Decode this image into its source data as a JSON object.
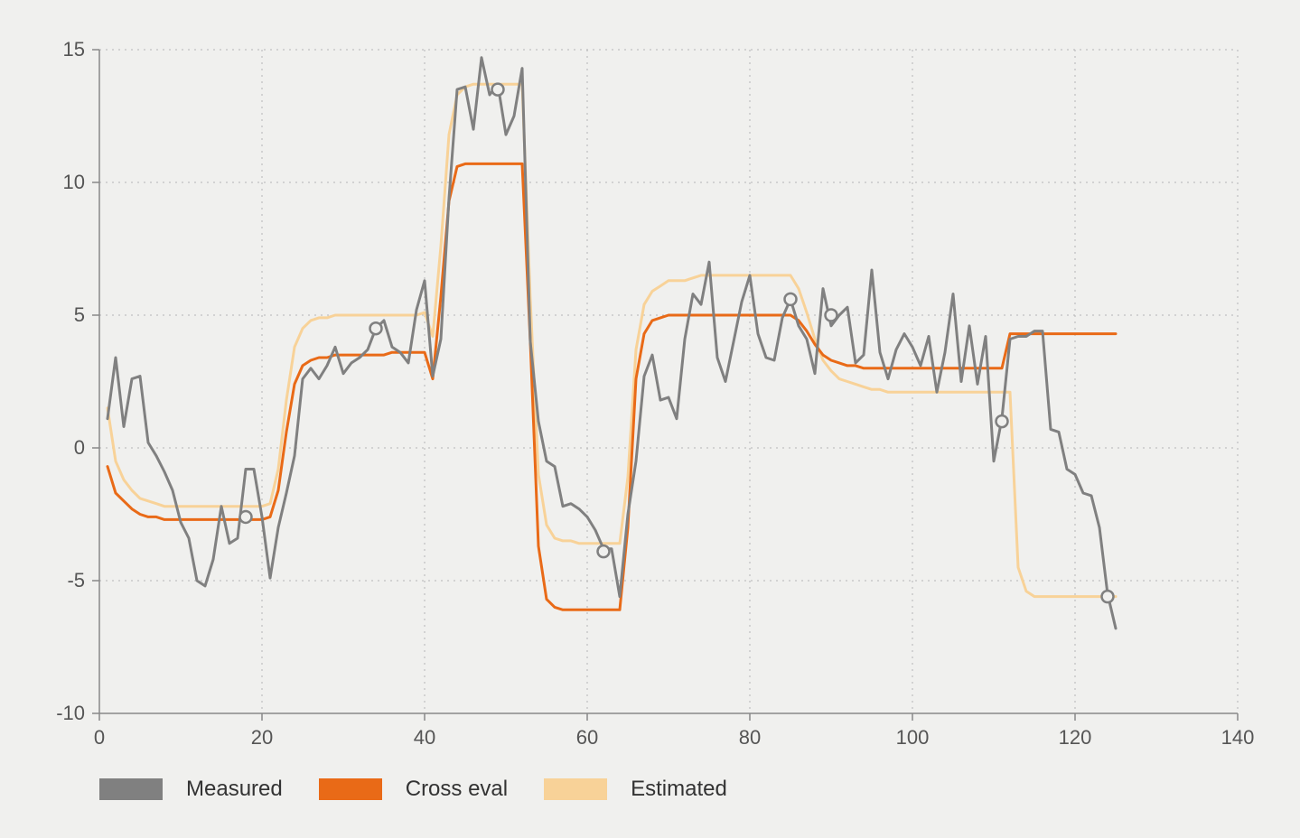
{
  "chart_data": {
    "type": "line",
    "xlabel": "",
    "ylabel": "",
    "xlim": [
      0,
      140
    ],
    "ylim": [
      -10,
      15
    ],
    "xticks": [
      0,
      20,
      40,
      60,
      80,
      100,
      120,
      140
    ],
    "yticks": [
      -10,
      -5,
      0,
      5,
      10,
      15
    ],
    "legend": [
      "Measured",
      "Cross eval",
      "Estimated"
    ],
    "series": [
      {
        "name": "Measured",
        "color": "#808080",
        "x": [
          1,
          2,
          3,
          4,
          5,
          6,
          7,
          8,
          9,
          10,
          11,
          12,
          13,
          14,
          15,
          16,
          17,
          18,
          19,
          20,
          21,
          22,
          23,
          24,
          25,
          26,
          27,
          28,
          29,
          30,
          31,
          32,
          33,
          34,
          35,
          36,
          37,
          38,
          39,
          40,
          41,
          42,
          43,
          44,
          45,
          46,
          47,
          48,
          49,
          50,
          51,
          52,
          53,
          54,
          55,
          56,
          57,
          58,
          59,
          60,
          61,
          62,
          63,
          64,
          65,
          66,
          67,
          68,
          69,
          70,
          71,
          72,
          73,
          74,
          75,
          76,
          77,
          78,
          79,
          80,
          81,
          82,
          83,
          84,
          85,
          86,
          87,
          88,
          89,
          90,
          91,
          92,
          93,
          94,
          95,
          96,
          97,
          98,
          99,
          100,
          101,
          102,
          103,
          104,
          105,
          106,
          107,
          108,
          109,
          110,
          111,
          112,
          113,
          114,
          115,
          116,
          117,
          118,
          119,
          120,
          121,
          122,
          123,
          124,
          125
        ],
        "y": [
          1.1,
          3.4,
          0.8,
          2.6,
          2.7,
          0.2,
          -0.3,
          -0.9,
          -1.6,
          -2.8,
          -3.4,
          -5.0,
          -5.2,
          -4.2,
          -2.2,
          -3.6,
          -3.4,
          -0.8,
          -0.8,
          -2.6,
          -4.9,
          -3.0,
          -1.7,
          -0.3,
          2.6,
          3.0,
          2.6,
          3.1,
          3.8,
          2.8,
          3.2,
          3.4,
          3.7,
          4.5,
          4.8,
          3.8,
          3.6,
          3.2,
          5.2,
          6.3,
          2.7,
          4.1,
          9.4,
          13.5,
          13.6,
          12.0,
          14.7,
          13.3,
          13.7,
          11.8,
          12.5,
          14.3,
          4.0,
          1.0,
          -0.5,
          -0.7,
          -2.2,
          -2.1,
          -2.3,
          -2.6,
          -3.1,
          -3.8,
          -3.8,
          -5.6,
          -2.5,
          -0.5,
          2.7,
          3.5,
          1.8,
          1.9,
          1.1,
          4.1,
          5.8,
          5.4,
          7.0,
          3.4,
          2.5,
          4.0,
          5.5,
          6.5,
          4.3,
          3.4,
          3.3,
          4.9,
          5.6,
          4.6,
          4.1,
          2.8,
          6.0,
          4.6,
          5.0,
          5.3,
          3.2,
          3.5,
          6.7,
          3.6,
          2.6,
          3.7,
          4.3,
          3.8,
          3.1,
          4.2,
          2.1,
          3.6,
          5.8,
          2.5,
          4.6,
          2.4,
          4.2,
          -0.5,
          1.1,
          4.1,
          4.2,
          4.2,
          4.4,
          4.4,
          0.7,
          0.6,
          -0.8,
          -1.0,
          -1.7,
          -1.8,
          -3.0,
          -5.5,
          -6.8
        ]
      },
      {
        "name": "Cross eval",
        "color": "#e96a17",
        "x": [
          1,
          2,
          3,
          4,
          5,
          6,
          7,
          8,
          9,
          10,
          11,
          12,
          13,
          14,
          15,
          16,
          17,
          18,
          19,
          20,
          21,
          22,
          23,
          24,
          25,
          26,
          27,
          28,
          29,
          30,
          31,
          32,
          33,
          34,
          35,
          36,
          37,
          38,
          39,
          40,
          41,
          42,
          43,
          44,
          45,
          46,
          47,
          48,
          49,
          50,
          51,
          52,
          53,
          54,
          55,
          56,
          57,
          58,
          59,
          60,
          61,
          62,
          63,
          64,
          65,
          66,
          67,
          68,
          69,
          70,
          71,
          72,
          73,
          74,
          75,
          76,
          77,
          78,
          79,
          80,
          81,
          82,
          83,
          84,
          85,
          86,
          87,
          88,
          89,
          90,
          91,
          92,
          93,
          94,
          95,
          96,
          97,
          98,
          99,
          100,
          101,
          102,
          103,
          104,
          105,
          106,
          107,
          108,
          109,
          110,
          111,
          112,
          113,
          114,
          115,
          116,
          117,
          118,
          119,
          120,
          121,
          122,
          123,
          124,
          125
        ],
        "y": [
          -0.7,
          -1.7,
          -2.0,
          -2.3,
          -2.5,
          -2.6,
          -2.6,
          -2.7,
          -2.7,
          -2.7,
          -2.7,
          -2.7,
          -2.7,
          -2.7,
          -2.7,
          -2.7,
          -2.7,
          -2.7,
          -2.7,
          -2.7,
          -2.6,
          -1.6,
          0.6,
          2.4,
          3.1,
          3.3,
          3.4,
          3.4,
          3.5,
          3.5,
          3.5,
          3.5,
          3.5,
          3.5,
          3.5,
          3.6,
          3.6,
          3.6,
          3.6,
          3.6,
          2.6,
          5.7,
          9.3,
          10.6,
          10.7,
          10.7,
          10.7,
          10.7,
          10.7,
          10.7,
          10.7,
          10.7,
          4.0,
          -3.7,
          -5.7,
          -6.0,
          -6.1,
          -6.1,
          -6.1,
          -6.1,
          -6.1,
          -6.1,
          -6.1,
          -6.1,
          -3.0,
          2.6,
          4.3,
          4.8,
          4.9,
          5.0,
          5.0,
          5.0,
          5.0,
          5.0,
          5.0,
          5.0,
          5.0,
          5.0,
          5.0,
          5.0,
          5.0,
          5.0,
          5.0,
          5.0,
          5.0,
          4.8,
          4.4,
          3.9,
          3.5,
          3.3,
          3.2,
          3.1,
          3.1,
          3.0,
          3.0,
          3.0,
          3.0,
          3.0,
          3.0,
          3.0,
          3.0,
          3.0,
          3.0,
          3.0,
          3.0,
          3.0,
          3.0,
          3.0,
          3.0,
          3.0,
          3.0,
          4.3,
          4.3,
          4.3,
          4.3,
          4.3,
          4.3,
          4.3,
          4.3,
          4.3,
          4.3,
          4.3,
          4.3,
          4.3,
          4.3
        ]
      },
      {
        "name": "Estimated",
        "color": "#f8d298",
        "x": [
          1,
          2,
          3,
          4,
          5,
          6,
          7,
          8,
          9,
          10,
          11,
          12,
          13,
          14,
          15,
          16,
          17,
          18,
          19,
          20,
          21,
          22,
          23,
          24,
          25,
          26,
          27,
          28,
          29,
          30,
          31,
          32,
          33,
          34,
          35,
          36,
          37,
          38,
          39,
          40,
          41,
          42,
          43,
          44,
          45,
          46,
          47,
          48,
          49,
          50,
          51,
          52,
          53,
          54,
          55,
          56,
          57,
          58,
          59,
          60,
          61,
          62,
          63,
          64,
          65,
          66,
          67,
          68,
          69,
          70,
          71,
          72,
          73,
          74,
          75,
          76,
          77,
          78,
          79,
          80,
          81,
          82,
          83,
          84,
          85,
          86,
          87,
          88,
          89,
          90,
          91,
          92,
          93,
          94,
          95,
          96,
          97,
          98,
          99,
          100,
          101,
          102,
          103,
          104,
          105,
          106,
          107,
          108,
          109,
          110,
          111,
          112,
          113,
          114,
          115,
          116,
          117,
          118,
          119,
          120,
          121,
          122,
          123,
          124,
          125
        ],
        "y": [
          1.5,
          -0.5,
          -1.2,
          -1.6,
          -1.9,
          -2.0,
          -2.1,
          -2.2,
          -2.2,
          -2.2,
          -2.2,
          -2.2,
          -2.2,
          -2.2,
          -2.2,
          -2.2,
          -2.2,
          -2.2,
          -2.2,
          -2.2,
          -2.1,
          -0.8,
          1.8,
          3.8,
          4.5,
          4.8,
          4.9,
          4.9,
          5.0,
          5.0,
          5.0,
          5.0,
          5.0,
          5.0,
          5.0,
          5.0,
          5.0,
          5.0,
          5.0,
          5.1,
          4.2,
          7.6,
          11.8,
          13.3,
          13.6,
          13.7,
          13.7,
          13.7,
          13.7,
          13.7,
          13.7,
          13.7,
          5.6,
          -1.0,
          -2.9,
          -3.4,
          -3.5,
          -3.5,
          -3.6,
          -3.6,
          -3.6,
          -3.6,
          -3.6,
          -3.6,
          -1.1,
          3.7,
          5.4,
          5.9,
          6.1,
          6.3,
          6.3,
          6.3,
          6.4,
          6.5,
          6.5,
          6.5,
          6.5,
          6.5,
          6.5,
          6.5,
          6.5,
          6.5,
          6.5,
          6.5,
          6.5,
          6.0,
          5.1,
          4.1,
          3.3,
          2.9,
          2.6,
          2.5,
          2.4,
          2.3,
          2.2,
          2.2,
          2.1,
          2.1,
          2.1,
          2.1,
          2.1,
          2.1,
          2.1,
          2.1,
          2.1,
          2.1,
          2.1,
          2.1,
          2.1,
          2.1,
          2.1,
          2.1,
          -4.5,
          -5.4,
          -5.6,
          -5.6,
          -5.6,
          -5.6,
          -5.6,
          -5.6,
          -5.6,
          -5.6,
          -5.6,
          -5.6,
          -5.6
        ]
      }
    ],
    "markers": {
      "name": "highlight-points",
      "color": "#808080",
      "points": [
        {
          "x": 18,
          "y": -2.6
        },
        {
          "x": 34,
          "y": 4.5
        },
        {
          "x": 49,
          "y": 13.5
        },
        {
          "x": 62,
          "y": -3.9
        },
        {
          "x": 85,
          "y": 5.6
        },
        {
          "x": 90,
          "y": 5.0
        },
        {
          "x": 111,
          "y": 1.0
        },
        {
          "x": 124,
          "y": -5.6
        }
      ]
    }
  },
  "legend_labels": {
    "measured": "Measured",
    "cross": "Cross eval",
    "estimated": "Estimated"
  }
}
